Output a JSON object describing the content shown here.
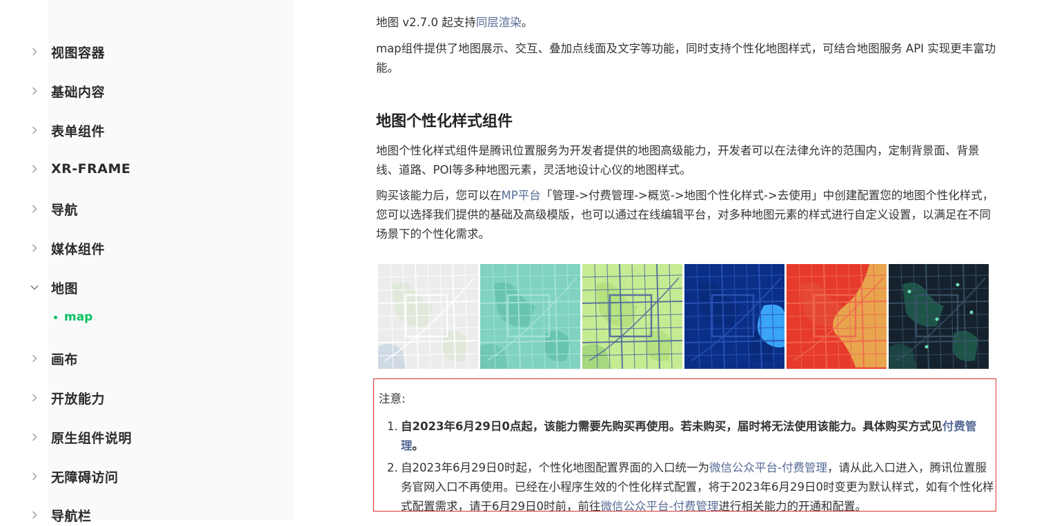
{
  "theme": {
    "link_color": "#576b95",
    "active_color": "#07c160",
    "note_border": "#d6312b"
  },
  "sidebar": {
    "items": [
      {
        "label": "视图容器",
        "expanded": false
      },
      {
        "label": "基础内容",
        "expanded": false
      },
      {
        "label": "表单组件",
        "expanded": false
      },
      {
        "label": "XR-FRAME",
        "expanded": false
      },
      {
        "label": "导航",
        "expanded": false
      },
      {
        "label": "媒体组件",
        "expanded": false
      },
      {
        "label": "地图",
        "expanded": true
      },
      {
        "label": "画布",
        "expanded": false
      },
      {
        "label": "开放能力",
        "expanded": false
      },
      {
        "label": "原生组件说明",
        "expanded": false
      },
      {
        "label": "无障碍访问",
        "expanded": false
      },
      {
        "label": "导航栏",
        "expanded": false
      }
    ],
    "active_subitem": "map"
  },
  "content": {
    "intro": {
      "prefix": "地图 v2.7.0 起支持",
      "link": "同层渲染",
      "suffix": "。"
    },
    "desc": "map组件提供了地图展示、交互、叠加点线面及文字等功能，同时支持个性化地图样式，可结合地图服务 API 实现更丰富功能。",
    "section_title": "地图个性化样式组件",
    "section_desc": "地图个性化样式组件是腾讯位置服务为开发者提供的地图高级能力，开发者可以在法律允许的范围内，定制背景面、背景线、道路、POI等多种地图元素，灵活地设计心仪的地图样式。",
    "purchase": {
      "prefix": "购买该能力后，您可以在",
      "link": "MP平台",
      "suffix": "「管理->付费管理->概览->地图个性化样式->去使用」中创建配置您的地图个性化样式，您可以选择我们提供的基础及高级模版，也可以通过在线编辑平台，对多种地图元素的样式进行自定义设置，以满足在不同场景下的个性化需求。"
    },
    "map_styles": [
      {
        "name": "light-gray-map",
        "bg": "#ececec",
        "road": "#ffffff",
        "water": "#c9d6e3",
        "green": "#dfe8d8"
      },
      {
        "name": "teal-map",
        "bg": "#7fd3c0",
        "road": "#a9e4d6",
        "water": "#6cc4b0",
        "green": "#66c2ad"
      },
      {
        "name": "green-yellow-map",
        "bg": "#c6ec93",
        "road": "#4e6a9c",
        "water": "#9cd37a",
        "green": "#b3e07e"
      },
      {
        "name": "dark-blue-map",
        "bg": "#0b2f86",
        "road": "#2a55b8",
        "water": "#3aa4f5",
        "green": "#0a2a7a"
      },
      {
        "name": "red-orange-map",
        "bg": "#e63a2b",
        "road": "#f0684f",
        "water": "#e8a54e",
        "green": "#e34a36"
      },
      {
        "name": "night-map",
        "bg": "#15222e",
        "road": "#3a5368",
        "water": "#1d4d47",
        "green": "#1e5a4a"
      }
    ],
    "note": {
      "title": "注意:",
      "items": [
        {
          "num": "1.",
          "text": "自2023年6月29日0点起，该能力需要先购买再使用。若未购买，届时将无法使用该能力。具体购买方式见",
          "link": "付费管理",
          "suffix": "。"
        },
        {
          "num": "2.",
          "text": "自2023年6月29日0时起，个性化地图配置界面的入口统一为",
          "link": "微信公众平台-付费管理",
          "middle": "，请从此入口进入，腾讯位置服务官网入口不再使用。已经在小程序生效的个性化样式配置，将于2023年6月29日0时变更为默认样式，如有个性化样式配置需求，请于6月29日0时前，前往",
          "link2": "微信公众平台-付费管理",
          "suffix": "进行相关能力的开通和配置。"
        }
      ]
    }
  }
}
